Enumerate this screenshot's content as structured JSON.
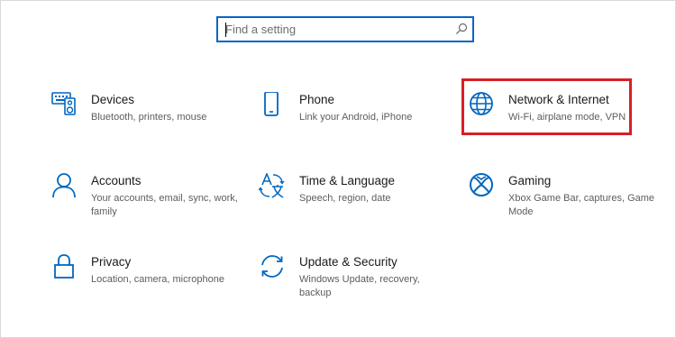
{
  "search": {
    "placeholder": "Find a setting",
    "icon": "search-icon"
  },
  "accent_color": "#0067c0",
  "highlight_color": "#d81f26",
  "tiles": [
    {
      "title": "Devices",
      "desc": "Bluetooth, printers, mouse",
      "icon": "devices-icon"
    },
    {
      "title": "Phone",
      "desc": "Link your Android, iPhone",
      "icon": "phone-icon"
    },
    {
      "title": "Network & Internet",
      "desc": "Wi-Fi, airplane mode, VPN",
      "icon": "globe-icon"
    },
    {
      "title": "Accounts",
      "desc": "Your accounts, email, sync, work, family",
      "icon": "person-icon"
    },
    {
      "title": "Time & Language",
      "desc": "Speech, region, date",
      "icon": "language-icon"
    },
    {
      "title": "Gaming",
      "desc": "Xbox Game Bar, captures, Game Mode",
      "icon": "xbox-icon"
    },
    {
      "title": "Privacy",
      "desc": "Location, camera, microphone",
      "icon": "lock-icon"
    },
    {
      "title": "Update & Security",
      "desc": "Windows Update, recovery, backup",
      "icon": "update-icon"
    }
  ]
}
